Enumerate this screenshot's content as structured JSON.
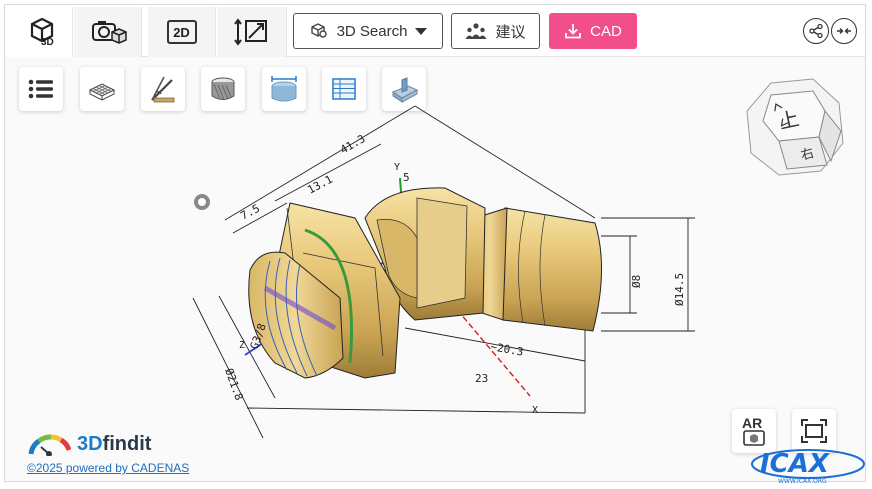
{
  "tabs": [
    {
      "label": "3D",
      "icon": "cube-icon",
      "active": true
    },
    {
      "label": "",
      "icon": "camera-cube-icon",
      "active": false
    },
    {
      "label": "2D",
      "icon": "2d-icon",
      "active": false
    },
    {
      "label": "",
      "icon": "measure-icon",
      "active": false
    }
  ],
  "toolbar": {
    "search_label": "3D Search",
    "suggest_label": "建议",
    "cad_label": "CAD",
    "cad_color": "#f24e8c"
  },
  "view_tools": [
    {
      "icon": "list-icon"
    },
    {
      "icon": "wireframe-icon"
    },
    {
      "icon": "measure-angle-icon"
    },
    {
      "icon": "section-cylinder-icon"
    },
    {
      "icon": "dimension-cylinder-icon"
    },
    {
      "icon": "table-icon"
    },
    {
      "icon": "fitting-part-icon"
    }
  ],
  "nav_cube": {
    "top_label": "上",
    "right_label": "右"
  },
  "drawing": {
    "dimensions": [
      "41.3",
      "13.1",
      "7.5",
      "G3/8",
      "Ø21.8",
      "Ø8",
      "Ø14.5",
      "~20.3",
      "23",
      "5"
    ],
    "axes": [
      "X",
      "Y",
      "Z"
    ]
  },
  "overlay_buttons": {
    "ar_label": "AR"
  },
  "brand": {
    "name_prefix": "3D",
    "name_suffix": "findit",
    "credit": "©2025 powered by CADENAS"
  },
  "watermark": {
    "text": "ICAX",
    "subtext": "WWW.ICAX.ORG"
  }
}
